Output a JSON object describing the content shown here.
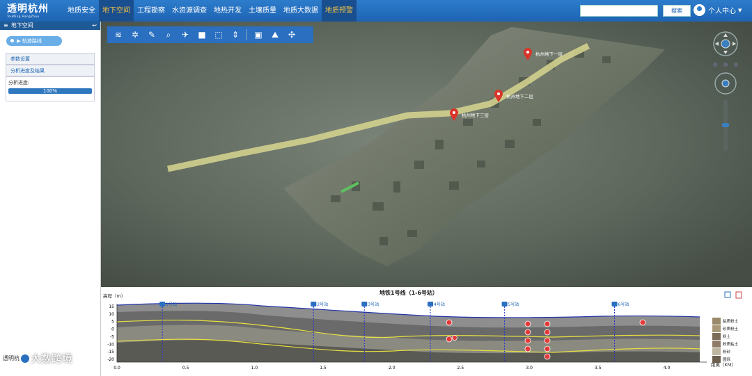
{
  "nav": {
    "logo_title": "透明杭州",
    "logo_sub": "TouMing HangZhou",
    "items": [
      {
        "label": "地质安全"
      },
      {
        "label": "地下空间"
      },
      {
        "label": "工程勘察"
      },
      {
        "label": "水资源调查"
      },
      {
        "label": "地热开发"
      },
      {
        "label": "土壤质量"
      },
      {
        "label": "地质大数据"
      },
      {
        "label": "地质预警"
      }
    ],
    "search_placeholder": "",
    "search_button": "搜索",
    "user_label": "个人中心"
  },
  "left": {
    "header": "地下空间",
    "track_button": "轨迹路线",
    "param_settings": "参数设置",
    "analysis_results": "分析进度及结果",
    "progress_label": "分析进度:",
    "progress_value": "100%",
    "progress_fraction": 1.0
  },
  "map": {
    "markers": [
      {
        "label": "杭州地下一层"
      },
      {
        "label": "杭州地下二层"
      },
      {
        "label": "杭州地下三层"
      }
    ]
  },
  "profile": {
    "title": "地铁1号线（1-6号站）",
    "y_axis_label": "高程（m）",
    "x_axis_label": "距离（KM）",
    "y_ticks": [
      "15",
      "10",
      "5",
      "0",
      "-5",
      "-10",
      "-15",
      "-20"
    ],
    "x_ticks": [
      "0.0",
      "0.5",
      "1.0",
      "1.5",
      "2.0",
      "2.5",
      "3.0",
      "3.5",
      "4.0"
    ],
    "stations": [
      {
        "label": "1号站",
        "km": 0.33
      },
      {
        "label": "2号站",
        "km": 1.43
      },
      {
        "label": "3号站",
        "km": 1.8
      },
      {
        "label": "4号站",
        "km": 2.28
      },
      {
        "label": "5号站",
        "km": 2.82
      },
      {
        "label": "6号站",
        "km": 3.62
      }
    ],
    "legend": [
      "粘质粉土",
      "砂质粉土",
      "粉土",
      "粉质粘土",
      "粉砂",
      "圆砾"
    ]
  },
  "watermark": "大数跨境",
  "watermark_small": "透明杭"
}
